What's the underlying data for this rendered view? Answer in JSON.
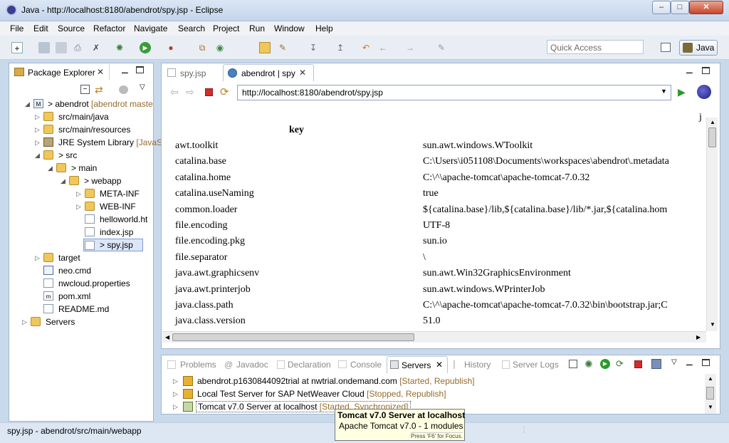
{
  "window": {
    "title": "Java - http://localhost:8180/abendrot/spy.jsp - Eclipse",
    "min": "–",
    "max": "□",
    "close": "✕"
  },
  "menu": [
    "File",
    "Edit",
    "Source",
    "Refactor",
    "Navigate",
    "Search",
    "Project",
    "Run",
    "Window",
    "Help"
  ],
  "toolbar": {
    "quick_access": "Quick Access",
    "perspective": "Java"
  },
  "explorer": {
    "title": "Package Explorer",
    "items": [
      {
        "label": "> abendrot",
        "suffix": " [abendrot maste"
      },
      {
        "label": "src/main/java"
      },
      {
        "label": "src/main/resources"
      },
      {
        "label": "JRE System Library",
        "suffix": " [JavaS"
      },
      {
        "label": "> src"
      },
      {
        "label": "> main"
      },
      {
        "label": "> webapp"
      },
      {
        "label": "META-INF"
      },
      {
        "label": "WEB-INF"
      },
      {
        "label": "helloworld.ht"
      },
      {
        "label": "index.jsp"
      },
      {
        "label": "> spy.jsp"
      },
      {
        "label": "target"
      },
      {
        "label": "neo.cmd"
      },
      {
        "label": "nwcloud.properties"
      },
      {
        "label": "pom.xml"
      },
      {
        "label": "README.md"
      },
      {
        "label": "Servers"
      }
    ]
  },
  "editor": {
    "tabs": [
      "spy.jsp",
      "abendrot | spy"
    ],
    "url": "http://localhost:8180/abendrot/spy.jsp",
    "corner_char": "j",
    "header": "key",
    "rows": [
      {
        "key": "awt.toolkit",
        "value": "sun.awt.windows.WToolkit"
      },
      {
        "key": "catalina.base",
        "value": "C:\\Users\\i051108\\Documents\\workspaces\\abendrot\\.metadata"
      },
      {
        "key": "catalina.home",
        "value": "C:\\^\\apache-tomcat\\apache-tomcat-7.0.32"
      },
      {
        "key": "catalina.useNaming",
        "value": "true"
      },
      {
        "key": "common.loader",
        "value": "${catalina.base}/lib,${catalina.base}/lib/*.jar,${catalina.hom"
      },
      {
        "key": "file.encoding",
        "value": "UTF-8"
      },
      {
        "key": "file.encoding.pkg",
        "value": "sun.io"
      },
      {
        "key": "file.separator",
        "value": "\\"
      },
      {
        "key": "java.awt.graphicsenv",
        "value": "sun.awt.Win32GraphicsEnvironment"
      },
      {
        "key": "java.awt.printerjob",
        "value": "sun.awt.windows.WPrinterJob"
      },
      {
        "key": "java.class.path",
        "value": "C:\\^\\apache-tomcat\\apache-tomcat-7.0.32\\bin\\bootstrap.jar;C"
      },
      {
        "key": "java.class.version",
        "value": "51.0"
      }
    ]
  },
  "bottom": {
    "tabs": [
      "Problems",
      "Javadoc",
      "Declaration",
      "Console",
      "Servers",
      "History",
      "Server Logs"
    ],
    "servers": [
      {
        "name": "abendrot.p1630844092trial at nwtrial.ondemand.com",
        "status": " [Started, Republish]"
      },
      {
        "name": "Local Test Server for SAP NetWeaver Cloud",
        "status": " [Stopped, Republish]"
      },
      {
        "name": "Tomcat v7.0 Server at localhost",
        "status": " [Started, Synchronized]"
      }
    ],
    "tooltip": {
      "title": "Tomcat v7.0 Server at localhost",
      "line": "Apache Tomcat v7.0 - 1 modules",
      "hint": "Press 'F6' for Focus."
    }
  },
  "statusbar": {
    "text": "spy.jsp - abendrot/src/main/webapp"
  }
}
